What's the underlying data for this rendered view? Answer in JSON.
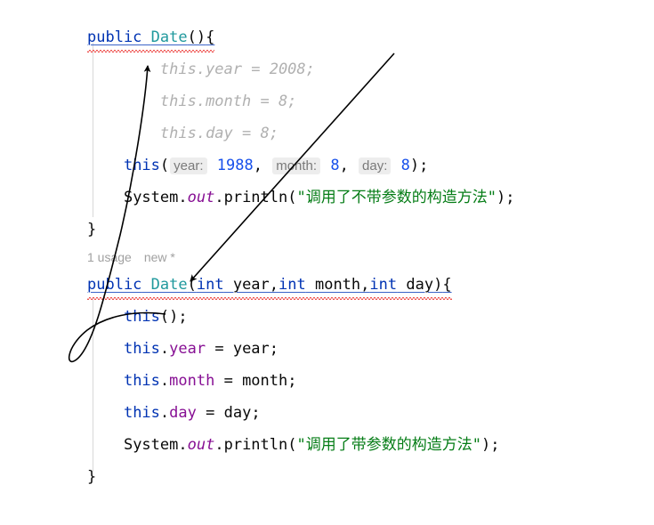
{
  "editor": {
    "language": "java",
    "colors": {
      "keyword": "#0033B3",
      "type": "#20999D",
      "field": "#871094",
      "static_italic": "#871094",
      "number": "#1750EB",
      "string": "#067D17",
      "muted_italic": "#B0B0B0",
      "error_squiggle": "#EF5350",
      "declaration_underline": "#3A63C8",
      "hint_chip_background": "#EDEDED",
      "hint_text": "#7A7A7A",
      "background": "#FFFFFF",
      "default_text": "#080808",
      "indent_guide": "#D8D8D8"
    }
  },
  "lines": [
    {
      "id": "line-ctor-noarg-signature",
      "kind": "declaration",
      "indent": "",
      "underlined": true,
      "error_squiggle": true,
      "tokens": [
        {
          "t": "public",
          "c": "kw"
        },
        {
          "t": " ",
          "c": "punc"
        },
        {
          "t": "Date",
          "c": "type"
        },
        {
          "t": "()",
          "c": "punc"
        },
        {
          "t": "{",
          "c": "punc"
        }
      ]
    },
    {
      "id": "line-this-year-2008",
      "kind": "muted",
      "indent": "        ",
      "text": "this.year = 2008;"
    },
    {
      "id": "line-this-month-8",
      "kind": "muted",
      "indent": "        ",
      "text": "this.month = 8;"
    },
    {
      "id": "line-this-day-8",
      "kind": "muted",
      "indent": "        ",
      "text": "this.day = 8;"
    },
    {
      "id": "line-this-call",
      "kind": "code",
      "indent": "    ",
      "tokens": [
        {
          "t": "this",
          "c": "kw"
        },
        {
          "t": "(",
          "c": "punc"
        },
        {
          "t": "year:",
          "c": "hint"
        },
        {
          "t": " ",
          "c": "punc"
        },
        {
          "t": "1988",
          "c": "num"
        },
        {
          "t": ", ",
          "c": "punc"
        },
        {
          "t": "month:",
          "c": "hint"
        },
        {
          "t": " ",
          "c": "punc"
        },
        {
          "t": "8",
          "c": "num"
        },
        {
          "t": ", ",
          "c": "punc"
        },
        {
          "t": "day:",
          "c": "hint"
        },
        {
          "t": " ",
          "c": "punc"
        },
        {
          "t": "8",
          "c": "num"
        },
        {
          "t": ");",
          "c": "punc"
        }
      ]
    },
    {
      "id": "line-println-noarg",
      "kind": "code",
      "indent": "    ",
      "tokens": [
        {
          "t": "System",
          "c": "ident"
        },
        {
          "t": ".",
          "c": "punc"
        },
        {
          "t": "out",
          "c": "static"
        },
        {
          "t": ".",
          "c": "punc"
        },
        {
          "t": "println",
          "c": "ident"
        },
        {
          "t": "(",
          "c": "punc"
        },
        {
          "t": "\"调用了不带参数的构造方法\"",
          "c": "str"
        },
        {
          "t": ");",
          "c": "punc"
        }
      ]
    },
    {
      "id": "line-close-brace-1",
      "kind": "code",
      "indent": "",
      "tokens": [
        {
          "t": "}",
          "c": "punc"
        }
      ]
    },
    {
      "id": "line-usage-hint",
      "kind": "gutter-hint",
      "usages": "1 usage",
      "new_marker": "new *"
    },
    {
      "id": "line-ctor-args-signature",
      "kind": "declaration",
      "indent": "",
      "underlined": true,
      "error_squiggle": true,
      "tokens": [
        {
          "t": "public",
          "c": "kw"
        },
        {
          "t": " ",
          "c": "punc"
        },
        {
          "t": "Date",
          "c": "type"
        },
        {
          "t": "(",
          "c": "punc"
        },
        {
          "t": "int",
          "c": "kw"
        },
        {
          "t": " year,",
          "c": "ident"
        },
        {
          "t": "int",
          "c": "kw"
        },
        {
          "t": " month,",
          "c": "ident"
        },
        {
          "t": "int",
          "c": "kw"
        },
        {
          "t": " day",
          "c": "ident"
        },
        {
          "t": ")",
          "c": "punc"
        },
        {
          "t": "{",
          "c": "punc"
        }
      ]
    },
    {
      "id": "line-this-default-call",
      "kind": "code",
      "indent": "    ",
      "tokens": [
        {
          "t": "this",
          "c": "kw"
        },
        {
          "t": "();",
          "c": "punc"
        }
      ]
    },
    {
      "id": "line-assign-year",
      "kind": "code",
      "indent": "    ",
      "tokens": [
        {
          "t": "this",
          "c": "kw"
        },
        {
          "t": ".",
          "c": "punc"
        },
        {
          "t": "year",
          "c": "field"
        },
        {
          "t": " = ",
          "c": "punc"
        },
        {
          "t": "year",
          "c": "ident"
        },
        {
          "t": ";",
          "c": "punc"
        }
      ]
    },
    {
      "id": "line-assign-month",
      "kind": "code",
      "indent": "    ",
      "tokens": [
        {
          "t": "this",
          "c": "kw"
        },
        {
          "t": ".",
          "c": "punc"
        },
        {
          "t": "month",
          "c": "field"
        },
        {
          "t": " = ",
          "c": "punc"
        },
        {
          "t": "month",
          "c": "ident"
        },
        {
          "t": ";",
          "c": "punc"
        }
      ]
    },
    {
      "id": "line-assign-day",
      "kind": "code",
      "indent": "    ",
      "tokens": [
        {
          "t": "this",
          "c": "kw"
        },
        {
          "t": ".",
          "c": "punc"
        },
        {
          "t": "day",
          "c": "field"
        },
        {
          "t": " = ",
          "c": "punc"
        },
        {
          "t": "day",
          "c": "ident"
        },
        {
          "t": ";",
          "c": "punc"
        }
      ]
    },
    {
      "id": "line-println-args",
      "kind": "code",
      "indent": "    ",
      "tokens": [
        {
          "t": "System",
          "c": "ident"
        },
        {
          "t": ".",
          "c": "punc"
        },
        {
          "t": "out",
          "c": "static"
        },
        {
          "t": ".",
          "c": "punc"
        },
        {
          "t": "println",
          "c": "ident"
        },
        {
          "t": "(",
          "c": "punc"
        },
        {
          "t": "\"调用了带参数的构造方法\"",
          "c": "str"
        },
        {
          "t": ");",
          "c": "punc"
        }
      ]
    },
    {
      "id": "line-close-brace-2",
      "kind": "code",
      "indent": "",
      "tokens": [
        {
          "t": "}",
          "c": "punc"
        }
      ]
    }
  ],
  "annotations": {
    "arrows": [
      {
        "id": "arrow-this-to-noarg-ctor",
        "from_label": "this();",
        "to_label": "public Date(){",
        "color": "#000000"
      },
      {
        "id": "arrow-thiscall-to-args-ctor",
        "from_label": "this( year: 1988, month: 8, day: 8);",
        "to_label": "public Date(int year,int month,int day){",
        "color": "#000000"
      }
    ]
  }
}
